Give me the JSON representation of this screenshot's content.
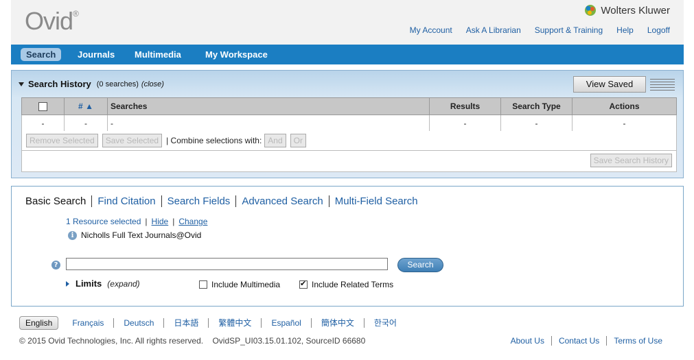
{
  "header": {
    "logo": "Ovid",
    "logo_mark": "®",
    "brand": "Wolters Kluwer",
    "links": [
      "My Account",
      "Ask A Librarian",
      "Support & Training",
      "Help",
      "Logoff"
    ]
  },
  "nav": {
    "tabs": [
      "Search",
      "Journals",
      "Multimedia",
      "My Workspace"
    ],
    "active": "Search"
  },
  "history": {
    "title": "Search History",
    "count": "(0 searches)",
    "close": "(close)",
    "view_saved": "View Saved",
    "columns": [
      "#",
      "Searches",
      "Results",
      "Search Type",
      "Actions"
    ],
    "sort_glyph": "▲",
    "row": [
      "-",
      "-",
      "-",
      "-",
      "-",
      "-"
    ],
    "remove_selected": "Remove Selected",
    "save_selected": "Save Selected",
    "combine_label": "| Combine selections with:",
    "and_label": "And",
    "or_label": "Or",
    "save_history": "Save Search History"
  },
  "search": {
    "tabs": [
      "Basic Search",
      "Find Citation",
      "Search Fields",
      "Advanced Search",
      "Multi-Field Search"
    ],
    "resource_selected": "1 Resource selected",
    "hide": "Hide",
    "change": "Change",
    "resource_name": "Nicholls Full Text Journals@Ovid",
    "input_value": "",
    "search_button": "Search",
    "limits": "Limits",
    "expand": "(expand)",
    "include_multimedia": "Include Multimedia",
    "include_multimedia_checked": false,
    "include_related": "Include Related Terms",
    "include_related_checked": true
  },
  "footer": {
    "languages": [
      "English",
      "Français",
      "Deutsch",
      "日本語",
      "繁體中文",
      "Español",
      "簡体中文",
      "한국어"
    ],
    "copyright": "© 2015 Ovid Technologies, Inc. All rights reserved.",
    "version": "OvidSP_UI03.15.01.102, SourceID 66680",
    "links": [
      "About Us",
      "Contact Us",
      "Terms of Use"
    ]
  },
  "colors": {
    "nav_blue": "#1b7ec2",
    "link_blue": "#1f5fa3"
  }
}
